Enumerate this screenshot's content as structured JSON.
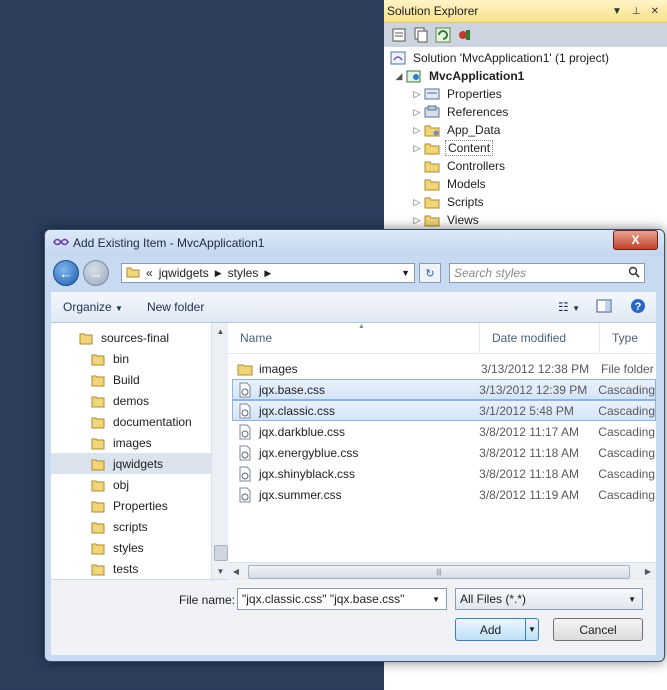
{
  "solution_explorer": {
    "title": "Solution Explorer",
    "solution_label": "Solution 'MvcApplication1' (1 project)",
    "project_label": "MvcApplication1",
    "items": [
      {
        "label": "Properties"
      },
      {
        "label": "References"
      },
      {
        "label": "App_Data"
      },
      {
        "label": "Content"
      },
      {
        "label": "Controllers"
      },
      {
        "label": "Models"
      },
      {
        "label": "Scripts"
      },
      {
        "label": "Views"
      }
    ]
  },
  "dialog": {
    "title": "Add Existing Item - MvcApplication1",
    "close_label": "X",
    "address": {
      "overflow": "«",
      "segments": [
        "jqwidgets",
        "styles"
      ]
    },
    "search_placeholder": "Search styles",
    "toolbar": {
      "organize": "Organize",
      "new_folder": "New folder"
    },
    "folder_tree": [
      {
        "label": "sources-final"
      },
      {
        "label": "bin"
      },
      {
        "label": "Build"
      },
      {
        "label": "demos"
      },
      {
        "label": "documentation"
      },
      {
        "label": "images"
      },
      {
        "label": "jqwidgets"
      },
      {
        "label": "obj"
      },
      {
        "label": "Properties"
      },
      {
        "label": "scripts"
      },
      {
        "label": "styles"
      },
      {
        "label": "tests"
      }
    ],
    "columns": {
      "name": "Name",
      "date": "Date modified",
      "type": "Type"
    },
    "files": [
      {
        "name": "images",
        "date": "3/13/2012 12:38 PM",
        "type": "File folder"
      },
      {
        "name": "jqx.base.css",
        "date": "3/13/2012 12:39 PM",
        "type": "Cascading"
      },
      {
        "name": "jqx.classic.css",
        "date": "3/1/2012 5:48 PM",
        "type": "Cascading"
      },
      {
        "name": "jqx.darkblue.css",
        "date": "3/8/2012 11:17 AM",
        "type": "Cascading"
      },
      {
        "name": "jqx.energyblue.css",
        "date": "3/8/2012 11:18 AM",
        "type": "Cascading"
      },
      {
        "name": "jqx.shinyblack.css",
        "date": "3/8/2012 11:18 AM",
        "type": "Cascading"
      },
      {
        "name": "jqx.summer.css",
        "date": "3/8/2012 11:19 AM",
        "type": "Cascading"
      }
    ],
    "file_name_label": "File name:",
    "file_name_value": "\"jqx.classic.css\" \"jqx.base.css\"",
    "file_type_value": "All Files (*.*)",
    "add_label": "Add",
    "cancel_label": "Cancel"
  }
}
